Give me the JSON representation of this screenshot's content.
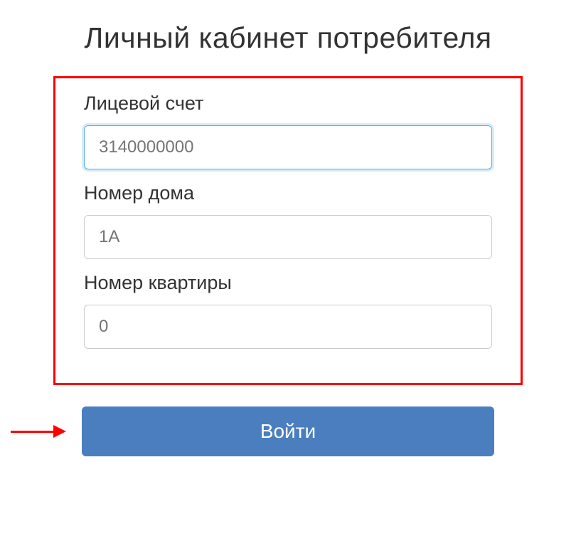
{
  "title": "Личный кабинет потребителя",
  "form": {
    "account": {
      "label": "Лицевой счет",
      "placeholder": "3140000000"
    },
    "house": {
      "label": "Номер дома",
      "placeholder": "1А"
    },
    "apartment": {
      "label": "Номер квартиры",
      "placeholder": "0"
    }
  },
  "submit_label": "Войти"
}
